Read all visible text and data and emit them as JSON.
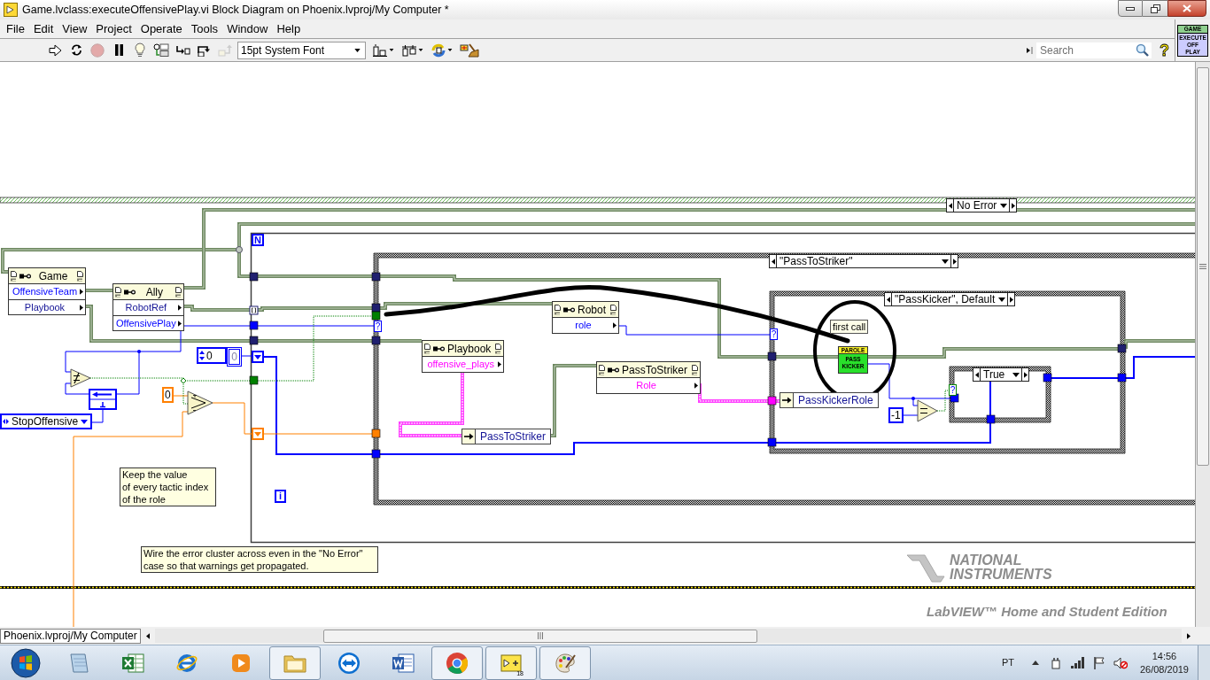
{
  "window": {
    "title": "Game.lvclass:executeOffensivePlay.vi Block Diagram on Phoenix.lvproj/My Computer *"
  },
  "menu": [
    "File",
    "Edit",
    "View",
    "Project",
    "Operate",
    "Tools",
    "Window",
    "Help"
  ],
  "toolbar": {
    "buttons": [
      {
        "kind": "run",
        "disabled": false
      },
      {
        "kind": "run_continuously",
        "disabled": false
      },
      {
        "kind": "abort",
        "disabled": true
      },
      {
        "kind": "pause",
        "disabled": false
      },
      {
        "kind": "highlight",
        "disabled": false
      },
      {
        "kind": "retain_values",
        "disabled": false
      },
      {
        "kind": "step_into",
        "disabled": false
      },
      {
        "kind": "step_over",
        "disabled": false
      },
      {
        "kind": "step_out",
        "disabled": true
      }
    ],
    "font": "15pt System Font",
    "tools": [
      {
        "kind": "align"
      },
      {
        "kind": "distribute"
      },
      {
        "kind": "reorder"
      },
      {
        "kind": "cleanup"
      }
    ],
    "search": {
      "placeholder": "Search"
    },
    "help": "?"
  },
  "vi_icon": {
    "banner": "GAME",
    "lines": [
      "EXECUTE",
      "OFF",
      "PLAY"
    ]
  },
  "diagram": {
    "structures": [
      {
        "label": "No Error"
      },
      {
        "label": "\"PassToStriker\"",
        "terminal": "?"
      },
      {
        "label": "\"PassKicker\", Default",
        "terminal": "?"
      },
      {
        "label": "True",
        "terminal": "?"
      }
    ],
    "for_loop": {
      "count_terminal": "N",
      "iteration_terminal": "i"
    },
    "unbundle_nodes": [
      {
        "name": "Game",
        "elements": [
          {
            "label": "OffensiveTeam",
            "color": "#0000ff"
          },
          {
            "label": "Playbook",
            "color": "#141496"
          }
        ]
      },
      {
        "name": "Ally",
        "elements": [
          {
            "label": "RobotRef",
            "color": "#141496"
          },
          {
            "label": "OffensivePlay",
            "color": "#0000ff"
          }
        ]
      },
      {
        "name": "Robot",
        "elements": [
          {
            "label": "role",
            "color": "#0000ff"
          }
        ]
      },
      {
        "name": "Playbook",
        "elements": [
          {
            "label": "offensive_plays",
            "color": "#ff00ff"
          }
        ]
      },
      {
        "name": "PassToStriker",
        "elements": [
          {
            "label": "Role",
            "color": "#ff00ff"
          }
        ]
      }
    ],
    "constants": [
      {
        "kind": "numeric_control",
        "value": "0"
      },
      {
        "kind": "numeric_indicator",
        "value": "0"
      },
      {
        "kind": "numeric",
        "value": "0",
        "color": "#ff8000"
      },
      {
        "kind": "enum",
        "value": "StopOffensive"
      },
      {
        "kind": "typedef",
        "value": "PassToStriker"
      },
      {
        "kind": "typedef",
        "value": "PassKickerRole"
      },
      {
        "kind": "numeric",
        "value": "-1",
        "color": "#0000ff"
      }
    ],
    "subvi": {
      "label": "first call",
      "banner": "PAROLE",
      "lines": [
        "PASS",
        "KICKER"
      ]
    },
    "comments": [
      {
        "lines": [
          "Keep the value",
          "of every tactic index",
          "of the role"
        ]
      },
      {
        "lines": [
          "Wire the error cluster across even in the \"No Error\"",
          "case so that warnings get propagated."
        ]
      }
    ]
  },
  "status_bar": {
    "context": "Phoenix.lvproj/My Computer"
  },
  "edition_mark": {
    "brand": [
      "NATIONAL",
      "INSTRUMENTS"
    ],
    "edition": "LabVIEW™ Home and Student Edition"
  },
  "taskbar": {
    "apps": [
      {
        "kind": "notepad",
        "running": false
      },
      {
        "kind": "excel",
        "running": false
      },
      {
        "kind": "ie",
        "running": false
      },
      {
        "kind": "media",
        "running": false
      },
      {
        "kind": "explorer",
        "running": true
      },
      {
        "kind": "teamviewer",
        "running": false
      },
      {
        "kind": "word",
        "running": false
      },
      {
        "kind": "chrome",
        "running": true
      },
      {
        "kind": "labview",
        "running": true,
        "badge": "18"
      },
      {
        "kind": "paint",
        "running": true
      }
    ],
    "tray": {
      "language": "PT",
      "time": "14:56",
      "date": "26/08/2019"
    }
  }
}
